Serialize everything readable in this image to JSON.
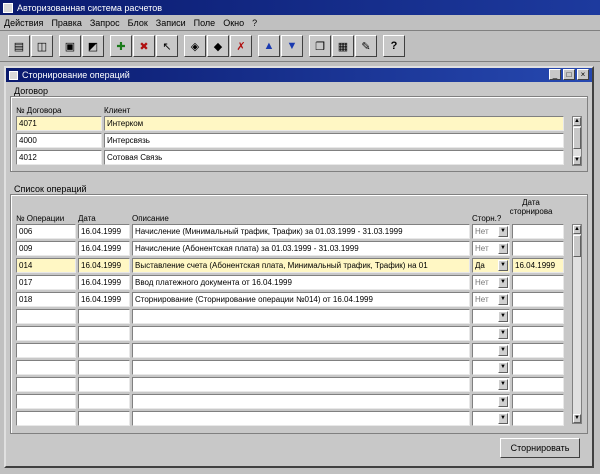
{
  "app": {
    "title": "Авторизованная система расчетов"
  },
  "menu": [
    "Действия",
    "Правка",
    "Запрос",
    "Блок",
    "Записи",
    "Поле",
    "Окно",
    "?"
  ],
  "toolbar_icons": [
    "print-icon",
    "preview-icon",
    "save-icon",
    "undo-icon",
    "insert-icon",
    "delete-icon",
    "clear-icon",
    "find-icon",
    "execute-icon",
    "cancel-query-icon",
    "up-arrow-icon",
    "down-arrow-icon",
    "copy-icon",
    "paste-icon",
    "edit-icon",
    "help-icon"
  ],
  "window": {
    "title": "Сторнирование операций",
    "buttons": [
      "_",
      "□",
      "×"
    ]
  },
  "contracts": {
    "group_label": "Договор",
    "headers": {
      "number": "№ Договора",
      "client": "Клиент"
    },
    "rows": [
      {
        "number": "4071",
        "client": "Интерком",
        "selected": true
      },
      {
        "number": "4000",
        "client": "Интерсвязь",
        "selected": false
      },
      {
        "number": "4012",
        "client": "Сотовая Связь",
        "selected": false
      }
    ]
  },
  "operations": {
    "group_label": "Список операций",
    "headers": {
      "number": "№ Операции",
      "date": "Дата",
      "description": "Описание",
      "storno": "Сторн.?",
      "storno_date": "Дата сторнирова"
    },
    "rows": [
      {
        "number": "006",
        "date": "16.04.1999",
        "description": "Начисление (Минимальный трафик, Трафик) за 01.03.1999 - 31.03.1999",
        "storno": "Нет",
        "storno_date": "",
        "selected": false
      },
      {
        "number": "009",
        "date": "16.04.1999",
        "description": "Начисление (Абонентская плата) за 01.03.1999 - 31.03.1999",
        "storno": "Нет",
        "storno_date": "",
        "selected": false
      },
      {
        "number": "014",
        "date": "16.04.1999",
        "description": "Выставление счета (Абонентская плата, Минимальный трафик, Трафик) на 01",
        "storno": "Да",
        "storno_date": "16.04.1999",
        "selected": true
      },
      {
        "number": "017",
        "date": "16.04.1999",
        "description": "Ввод платежного документа от 16.04.1999",
        "storno": "Нет",
        "storno_date": "",
        "selected": false
      },
      {
        "number": "018",
        "date": "16.04.1999",
        "description": "Сторнирование (Сторнирование операции №014) от 16.04.1999",
        "storno": "Нет",
        "storno_date": "",
        "selected": false
      }
    ],
    "empty_rows": 7
  },
  "action": {
    "storno_button": "Сторнировать"
  }
}
